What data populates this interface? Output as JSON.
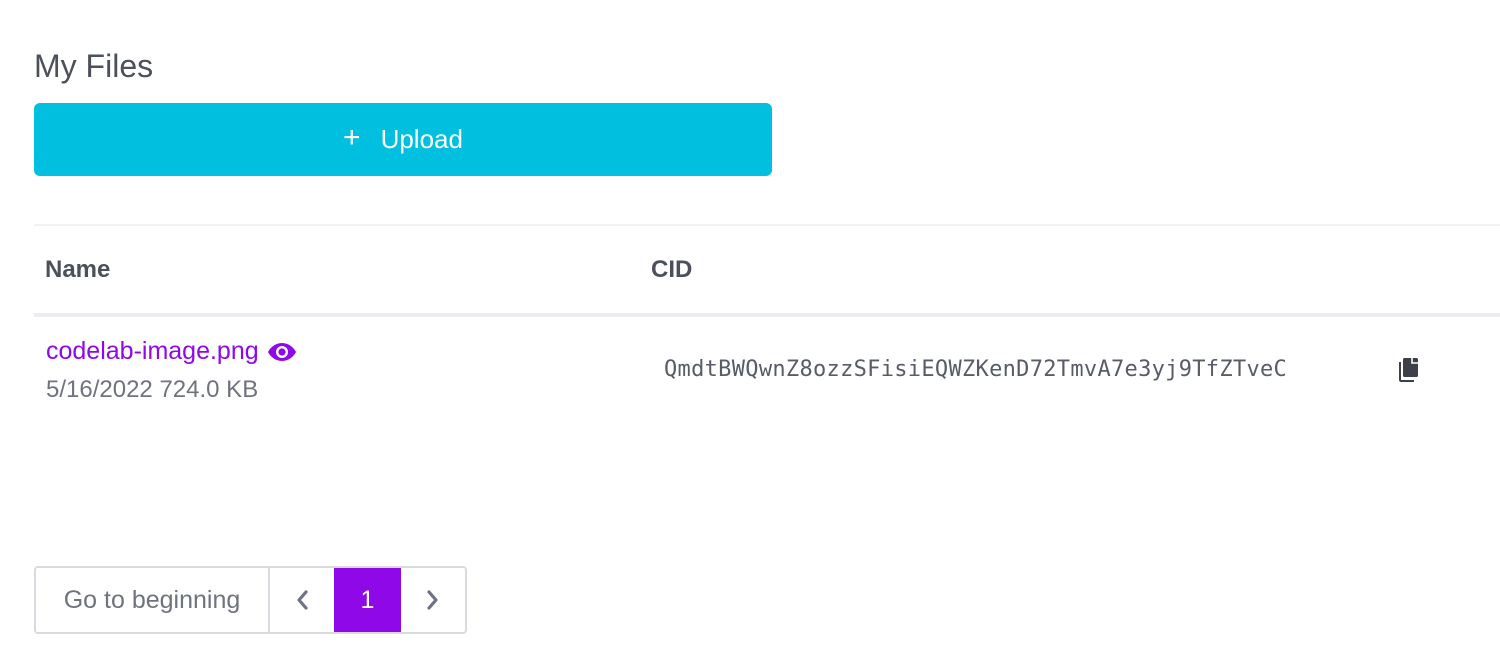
{
  "page": {
    "title": "My Files"
  },
  "upload": {
    "icon": "plus-icon",
    "plus": "+",
    "label": "Upload",
    "color": "#00bfdf"
  },
  "table": {
    "headers": {
      "name": "Name",
      "cid": "CID"
    },
    "rows": [
      {
        "name": "codelab-image.png",
        "date": "5/16/2022",
        "size": "724.0 KB",
        "cid": "QmdtBWQwnZ8ozzSFisiEQWZKenD72TmvA7e3yj9TfZTveC",
        "view_icon": "eye-icon",
        "copy_icon": "copy-icon"
      }
    ]
  },
  "pagination": {
    "begin_label": "Go to beginning",
    "prev_icon": "chevron-left-icon",
    "current_page": "1",
    "next_icon": "chevron-right-icon",
    "accent": "#8e08e8"
  }
}
